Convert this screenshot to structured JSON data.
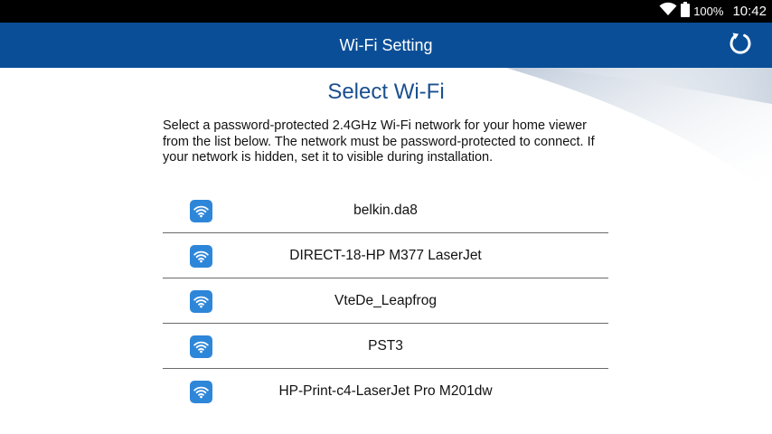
{
  "status_bar": {
    "battery": "100%",
    "time": "10:42",
    "icons": [
      "wifi-signal-icon",
      "battery-icon"
    ]
  },
  "app_bar": {
    "title": "Wi-Fi Setting",
    "refresh_icon": "refresh-icon"
  },
  "main": {
    "heading": "Select Wi-Fi",
    "description": "Select a password-protected 2.4GHz Wi-Fi network for your home viewer from the list below. The network must be password-protected to connect. If your network is hidden, set it to visible during installation.",
    "networks": [
      {
        "name": "belkin.da8",
        "icon": "wifi-icon"
      },
      {
        "name": "DIRECT-18-HP M377 LaserJet",
        "icon": "wifi-icon"
      },
      {
        "name": "VteDe_Leapfrog",
        "icon": "wifi-icon"
      },
      {
        "name": "PST3",
        "icon": "wifi-icon"
      },
      {
        "name": "HP-Print-c4-LaserJet Pro M201dw",
        "icon": "wifi-icon"
      }
    ]
  },
  "colors": {
    "app_bar": "#0a4e97",
    "heading": "#1a4f8f",
    "wifi_badge": "#2e86d9",
    "status_bar": "#000000"
  }
}
